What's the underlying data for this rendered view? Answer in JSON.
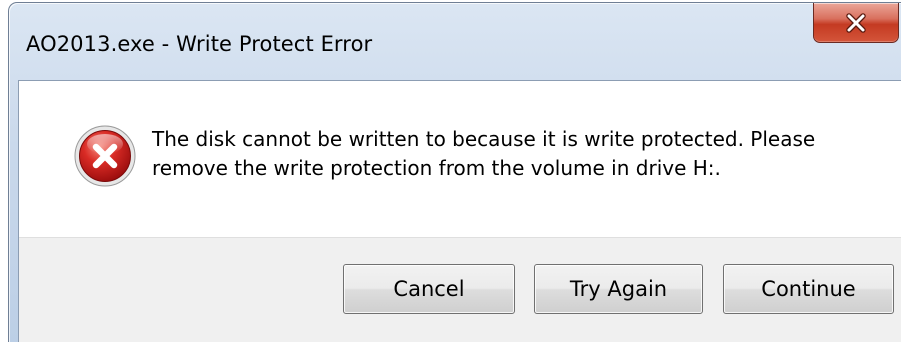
{
  "window": {
    "title": "AO2013.exe - Write Protect Error"
  },
  "icons": {
    "close": "close-icon",
    "error": "error-icon"
  },
  "message": {
    "text": "The disk cannot be written to because it is write protected. Please\nremove the write protection from the volume  in drive H:."
  },
  "buttons": {
    "cancel": "Cancel",
    "try_again": "Try Again",
    "continue": "Continue"
  },
  "colors": {
    "close_button": "#c43a22",
    "error_icon": "#c1121f",
    "dialog_button_area": "#f0f0f0"
  }
}
